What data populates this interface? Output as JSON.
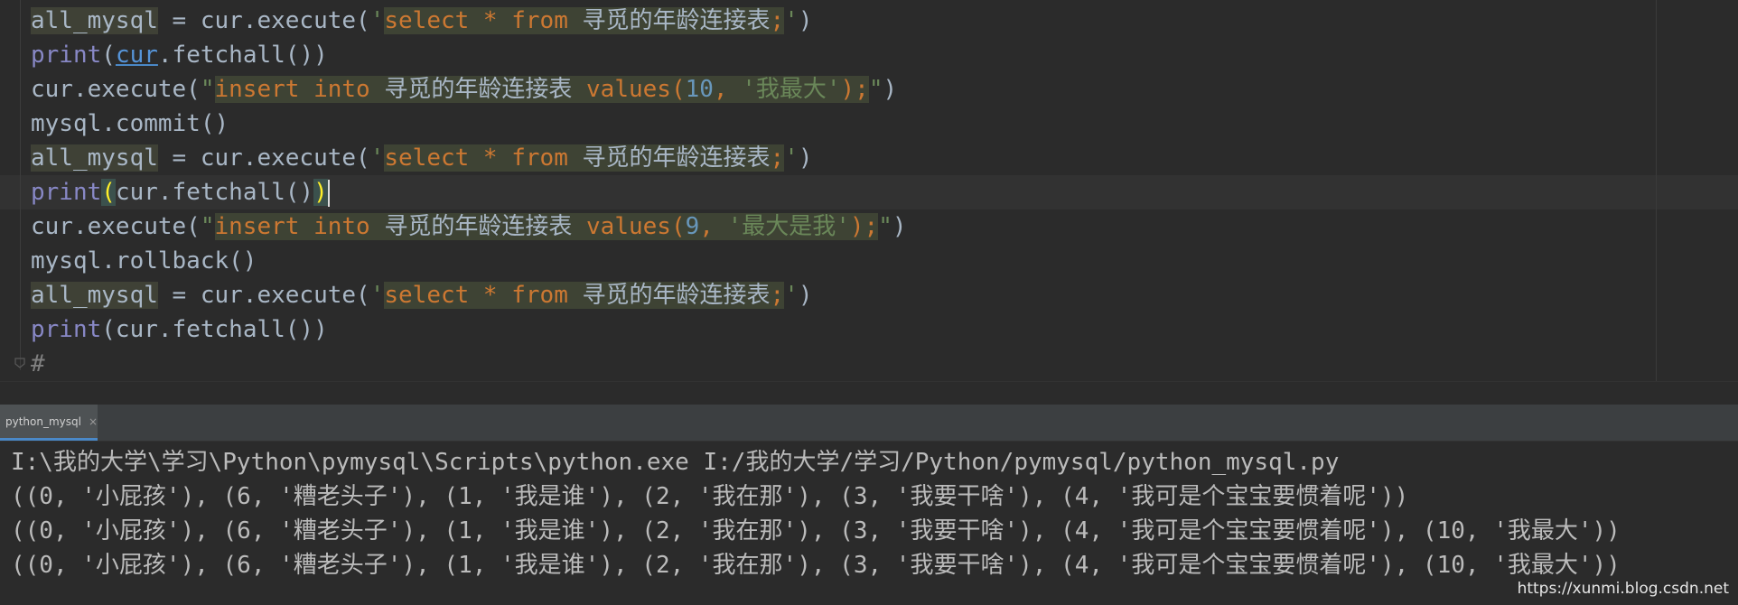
{
  "editor": {
    "lines": [
      {
        "a": "all_mysql",
        "b": " = cur.execute(",
        "c": "'",
        "d": "select",
        "e": " * ",
        "f": "from",
        "g": " 寻觅的年龄连接表",
        "h": ";",
        "i": "'",
        "j": ")"
      },
      {
        "a": "print",
        "b": "(",
        "c": "cur",
        "d": ".fetchall())"
      },
      {
        "a": "cur.execute(",
        "b": "\"",
        "c": "insert",
        "d": " ",
        "e": "into",
        "f": " 寻觅的年龄连接表 ",
        "g": "values",
        "h": "(",
        "i": "10",
        "j": ", ",
        "k": "'我最大'",
        "l": ");",
        "m": "\"",
        "n": ")"
      },
      {
        "a": "mysql.commit()"
      },
      {
        "a": "all_mysql",
        "b": " = cur.execute(",
        "c": "'",
        "d": "select",
        "e": " * ",
        "f": "from",
        "g": " 寻觅的年龄连接表",
        "h": ";",
        "i": "'",
        "j": ")"
      },
      {
        "a": "print",
        "b": "(",
        "c": "cur.fetchall()",
        "d": ")"
      },
      {
        "a": "cur.execute(",
        "b": "\"",
        "c": "insert",
        "d": " ",
        "e": "into",
        "f": " 寻觅的年龄连接表 ",
        "g": "values",
        "h": "(",
        "i": "9",
        "j": ", ",
        "k": "'最大是我'",
        "l": ");",
        "m": "\"",
        "n": ")"
      },
      {
        "a": "mysql.rollback()"
      },
      {
        "a": "all_mysql",
        "b": " = cur.execute(",
        "c": "'",
        "d": "select",
        "e": " * ",
        "f": "from",
        "g": " 寻觅的年龄连接表",
        "h": ";",
        "i": "'",
        "j": ")"
      },
      {
        "a": "print",
        "b": "(cur.fetchall())"
      },
      {
        "a": "#"
      }
    ]
  },
  "run_panel": {
    "tab_label": "python_mysql",
    "close_glyph": "×"
  },
  "console": {
    "lines": [
      "I:\\我的大学\\学习\\Python\\pymysql\\Scripts\\python.exe I:/我的大学/学习/Python/pymysql/python_mysql.py",
      "((0, '小屁孩'), (6, '糟老头子'), (1, '我是谁'), (2, '我在那'), (3, '我要干啥'), (4, '我可是个宝宝要惯着呢'))",
      "((0, '小屁孩'), (6, '糟老头子'), (1, '我是谁'), (2, '我在那'), (3, '我要干啥'), (4, '我可是个宝宝要惯着呢'), (10, '我最大'))",
      "((0, '小屁孩'), (6, '糟老头子'), (1, '我是谁'), (2, '我在那'), (3, '我要干啥'), (4, '我可是个宝宝要惯着呢'), (10, '我最大'))"
    ]
  },
  "watermark": "https://xunmi.blog.csdn.net"
}
